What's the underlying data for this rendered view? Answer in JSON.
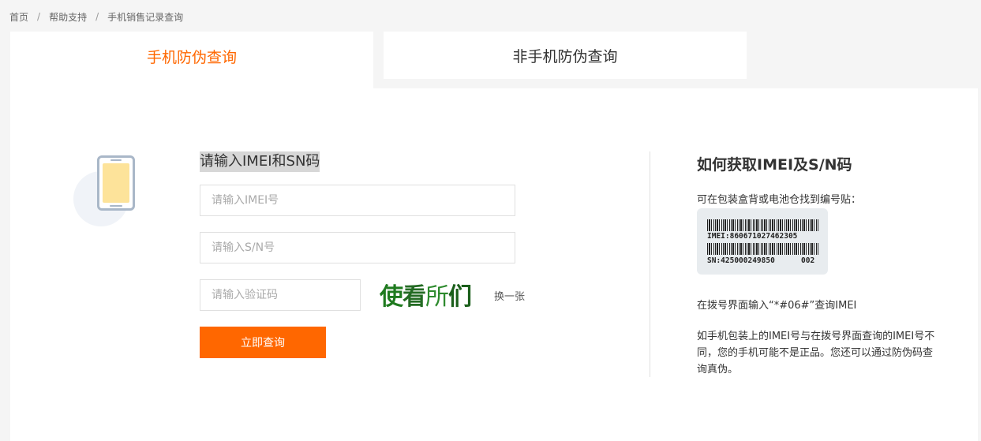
{
  "breadcrumb": {
    "items": [
      "首页",
      "帮助支持",
      "手机销售记录查询"
    ],
    "separator": "/"
  },
  "tabs": [
    {
      "label": "手机防伪查询",
      "active": true
    },
    {
      "label": "非手机防伪查询",
      "active": false
    }
  ],
  "form": {
    "title": "请输入IMEI和SN码",
    "imei_placeholder": "请输入IMEI号",
    "sn_placeholder": "请输入S/N号",
    "code_placeholder": "请输入验证码",
    "captcha_chars": [
      "使",
      "看",
      "所",
      "们"
    ],
    "refresh_label": "换一张",
    "submit_label": "立即查询"
  },
  "help": {
    "title": "如何获取IMEI及S/N码",
    "subtitle": "可在包装盒背或电池仓找到编号贴：",
    "label_imei": "IMEI:860671027462305",
    "label_sn": "SN:425000249850",
    "label_code": "002",
    "dial_text": "在拨号界面输入“*#06#”查询IMEI",
    "note": "如手机包装上的IMEI号与在拨号界面查询的IMEI号不同，您的手机可能不是正品。您还可以通过防伪码查询真伪。"
  },
  "colors": {
    "accent": "#ff6700",
    "page_bg": "#f5f5f5",
    "panel_bg": "#ffffff",
    "captcha_green": "#1f7a1f"
  }
}
